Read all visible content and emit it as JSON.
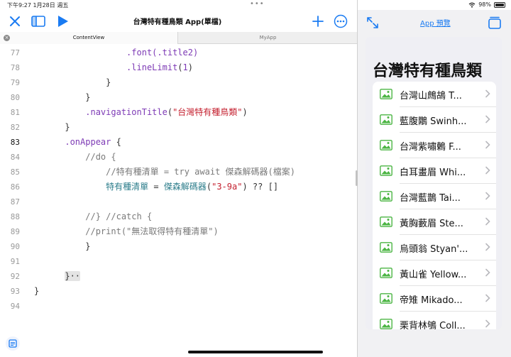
{
  "status_bar": {
    "time": "下午9:27  1月28日 週五",
    "battery": "98%",
    "battery_level": 0.98
  },
  "toolbar": {
    "title": "台灣特有種鳥類 App(單檔)"
  },
  "tabs": [
    {
      "label": "ContentView"
    },
    {
      "label": "MyApp"
    }
  ],
  "code_lines": [
    {
      "num": "77",
      "parts": [
        {
          "t": "                  "
        },
        {
          "t": ".font(.title2)",
          "c": "fn"
        }
      ]
    },
    {
      "num": "78",
      "parts": [
        {
          "t": "                  "
        },
        {
          "t": ".lineLimit",
          "c": "fn"
        },
        {
          "t": "("
        },
        {
          "t": "1",
          "c": "fn"
        },
        {
          "t": ")"
        }
      ]
    },
    {
      "num": "79",
      "parts": [
        {
          "t": "              }"
        }
      ]
    },
    {
      "num": "80",
      "parts": [
        {
          "t": "          }"
        }
      ]
    },
    {
      "num": "81",
      "parts": [
        {
          "t": "          "
        },
        {
          "t": ".navigationTitle",
          "c": "fn"
        },
        {
          "t": "("
        },
        {
          "t": "\"台灣特有種鳥類\"",
          "c": "str"
        },
        {
          "t": ")"
        }
      ]
    },
    {
      "num": "82",
      "parts": [
        {
          "t": "      }"
        }
      ]
    },
    {
      "num": "83",
      "current": true,
      "parts": [
        {
          "t": "      "
        },
        {
          "t": ".onAppear",
          "c": "fn"
        },
        {
          "t": " {"
        }
      ]
    },
    {
      "num": "84",
      "parts": [
        {
          "t": "          "
        },
        {
          "t": "//do {",
          "c": "cmt"
        }
      ]
    },
    {
      "num": "85",
      "parts": [
        {
          "t": "              "
        },
        {
          "t": "//特有種清單 = try await 傑森解碼器(檔案)",
          "c": "cmt"
        }
      ]
    },
    {
      "num": "86",
      "parts": [
        {
          "t": "              "
        },
        {
          "t": "特有種清單",
          "c": "teal"
        },
        {
          "t": " = "
        },
        {
          "t": "傑森解碼器",
          "c": "teal"
        },
        {
          "t": "("
        },
        {
          "t": "\"3-9a\"",
          "c": "str"
        },
        {
          "t": ") ?? []"
        }
      ]
    },
    {
      "num": "87",
      "parts": [
        {
          "t": ""
        }
      ]
    },
    {
      "num": "88",
      "parts": [
        {
          "t": "          "
        },
        {
          "t": "//} //catch {",
          "c": "cmt"
        }
      ]
    },
    {
      "num": "89",
      "parts": [
        {
          "t": "          "
        },
        {
          "t": "//print(\"無法取得特有種清單\")",
          "c": "cmt"
        }
      ]
    },
    {
      "num": "90",
      "parts": [
        {
          "t": "          }"
        }
      ]
    },
    {
      "num": "91",
      "parts": [
        {
          "t": ""
        }
      ]
    },
    {
      "num": "92",
      "parts": [
        {
          "t": "      "
        },
        {
          "t": "}··",
          "c": "brace-hl"
        }
      ]
    },
    {
      "num": "93",
      "parts": [
        {
          "t": "}"
        }
      ]
    },
    {
      "num": "94",
      "parts": [
        {
          "t": ""
        }
      ]
    }
  ],
  "preview": {
    "link_label": "App 預覽",
    "nav_title": "台灣特有種鳥類",
    "items": [
      "台灣山鷓鴣 T...",
      "藍腹鷴 Swinh...",
      "台灣紫嘯鶇 F...",
      "白耳畫眉 Whi...",
      "台灣藍鵲 Tai...",
      "黃胸藪眉 Ste...",
      "烏頭翁 Styan'...",
      "黃山雀 Yellow...",
      "帝雉 Mikado...",
      "栗背林鴝 Coll..."
    ]
  },
  "colors": {
    "accent": "#1a7bf2",
    "keyword": "#7d3ab5",
    "string": "#c4202f",
    "comment": "#7a7a7a",
    "identifier": "#2c7d8b",
    "image_icon": "#4bb543"
  },
  "icons": [
    "close-icon",
    "sidebar-icon",
    "play-icon",
    "plus-icon",
    "more-icon",
    "expand-icon",
    "windows-icon",
    "docs-icon",
    "photo-icon",
    "chevron-right-icon",
    "wifi-icon",
    "battery-icon"
  ]
}
